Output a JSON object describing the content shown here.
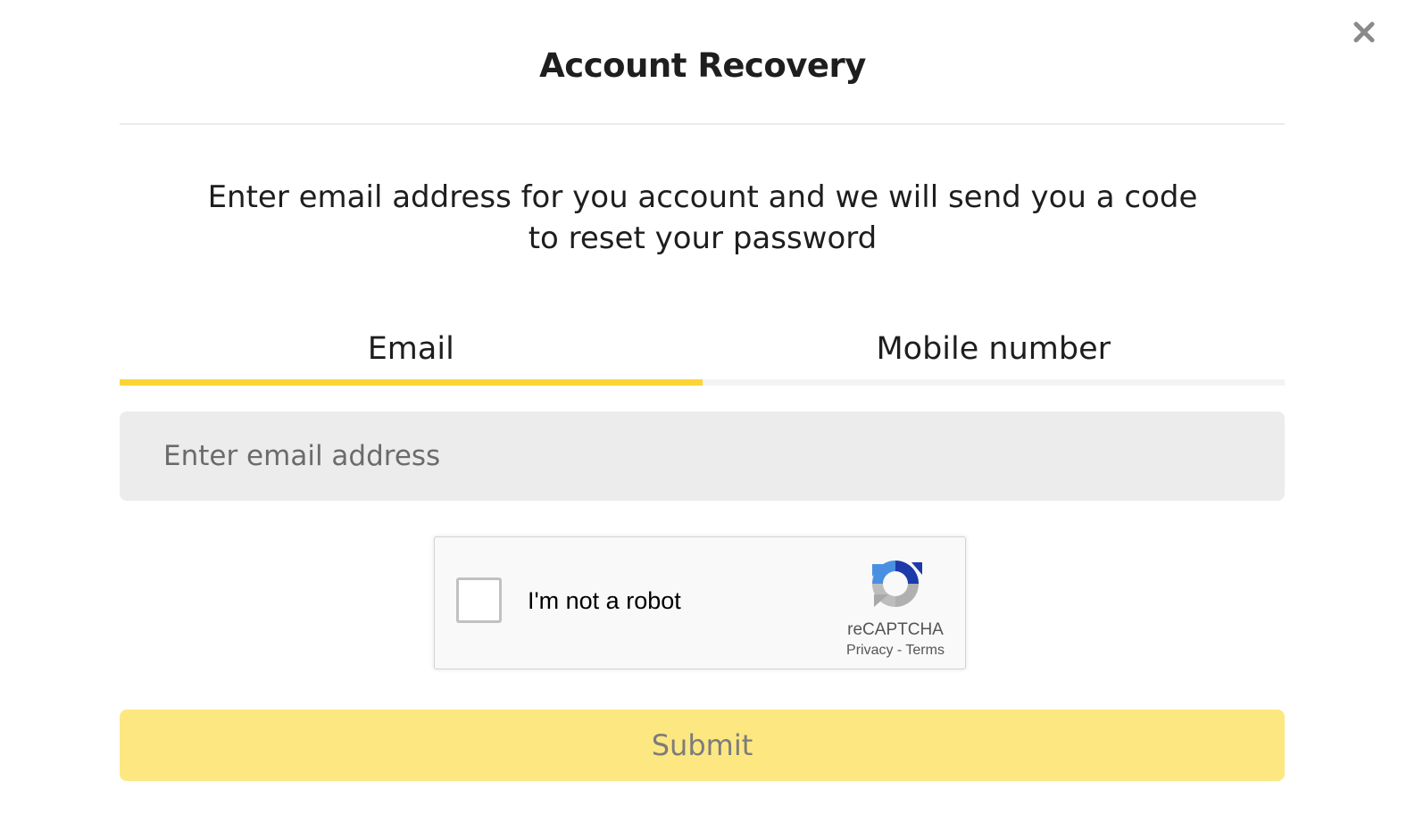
{
  "modal": {
    "title": "Account Recovery",
    "close_icon": "close-icon",
    "intro": "Enter email address for you account and we will send you a code to reset your password"
  },
  "tabs": [
    {
      "label": "Email",
      "active": true
    },
    {
      "label": "Mobile number",
      "active": false
    }
  ],
  "email_input": {
    "value": "",
    "placeholder": "Enter email address"
  },
  "recaptcha": {
    "checkbox_label": "I'm not a robot",
    "checked": false,
    "brand": "reCAPTCHA",
    "privacy": "Privacy",
    "separator": " - ",
    "terms": "Terms",
    "logo_icon": "recaptcha-logo-icon"
  },
  "submit": {
    "label": "Submit",
    "enabled": false
  },
  "colors": {
    "accent": "#fcd535",
    "submit_disabled_bg": "#fde781",
    "input_bg": "#ececec"
  }
}
